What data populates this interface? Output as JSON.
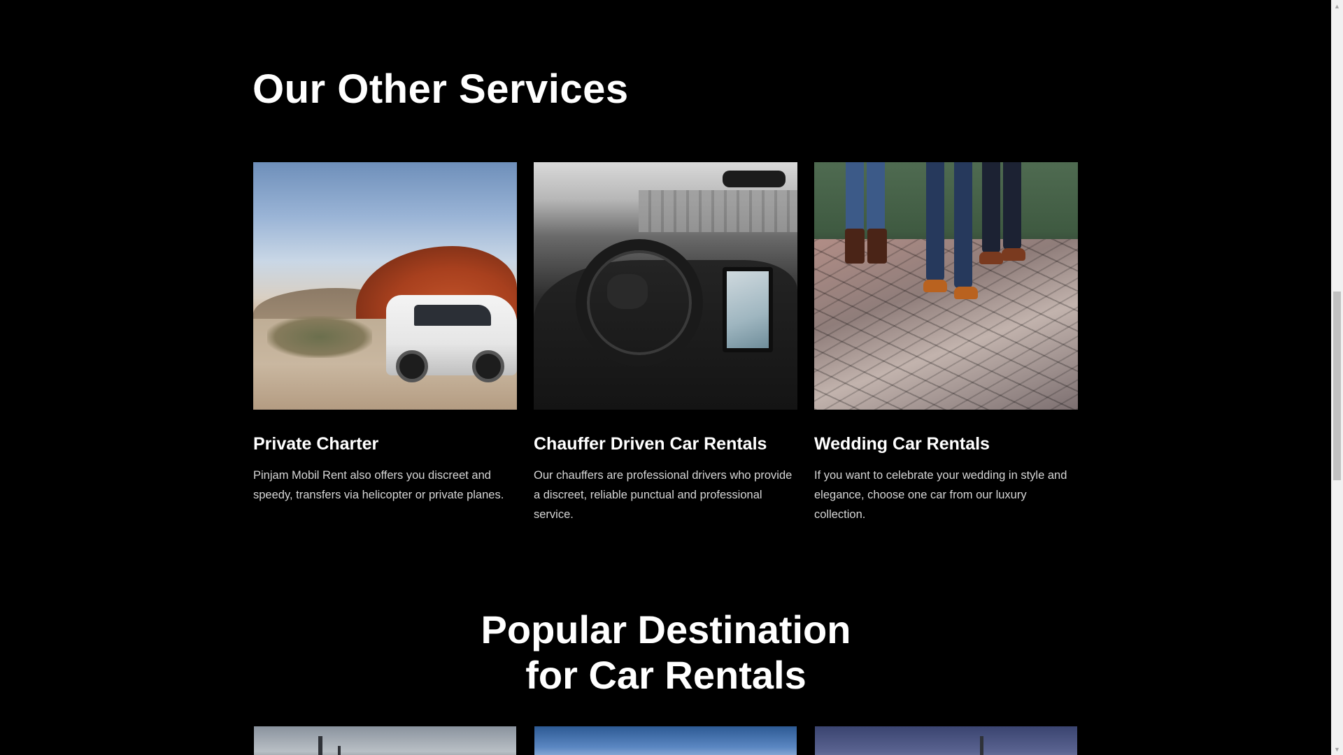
{
  "services": {
    "title": "Our Other Services",
    "cards": [
      {
        "title": "Private Charter",
        "description": "Pinjam Mobil Rent also offers you discreet and speedy, transfers via helicopter or private planes.",
        "image": "white-suv-desert-photo"
      },
      {
        "title": "Chauffer Driven Car Rentals",
        "description": "Our chauffers are professional drivers who provide a discreet, reliable punctual and professional service.",
        "image": "car-interior-dashboard-photo"
      },
      {
        "title": "Wedding Car Rentals",
        "description": "If you want to celebrate your wedding in style and elegance, choose one car from our luxury collection.",
        "image": "wedding-guests-by-car-photo"
      }
    ]
  },
  "destinations": {
    "title_line1": "Popular Destination",
    "title_line2": "for Car Rentals",
    "images": [
      "city-landmark-photo",
      "blue-sky-city-photo",
      "tower-dusk-photo"
    ]
  },
  "scrollbar": {
    "up_icon": "▲",
    "down_icon": "▼"
  },
  "colors": {
    "background": "#000000",
    "text": "#ffffff",
    "body_text": "#d6d6d6"
  }
}
